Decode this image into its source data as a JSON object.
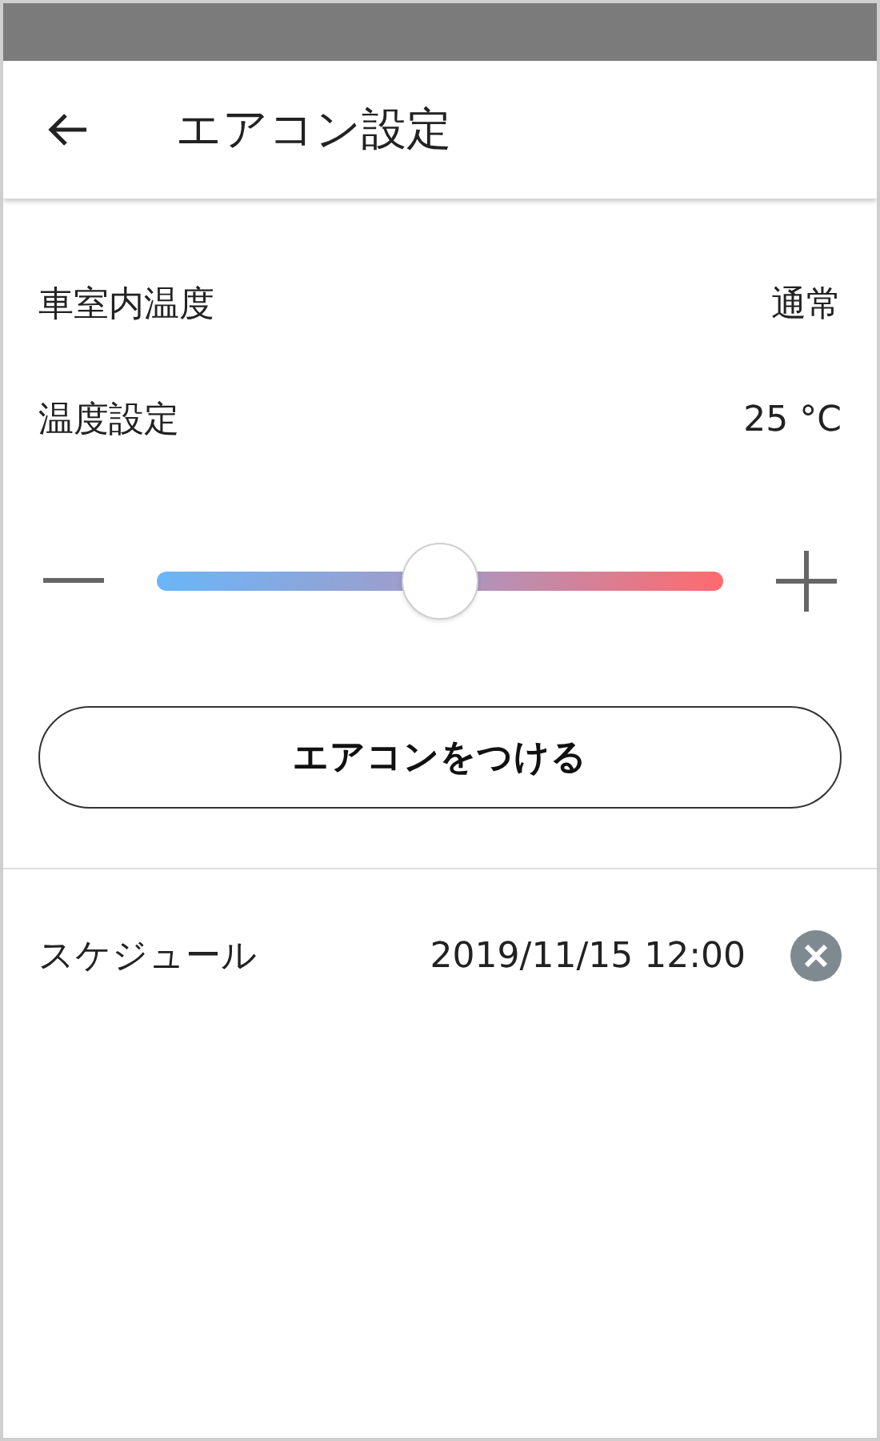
{
  "header": {
    "title": "エアコン設定"
  },
  "rows": [
    {
      "label": "車室内温度",
      "value": "通常"
    },
    {
      "label": "温度設定",
      "value": "25 °C"
    }
  ],
  "slider": {
    "level": 0.5
  },
  "power_button": {
    "label": "エアコンをつける"
  },
  "schedule": {
    "label": "スケジュール",
    "value": "2019/11/15 12:00"
  }
}
